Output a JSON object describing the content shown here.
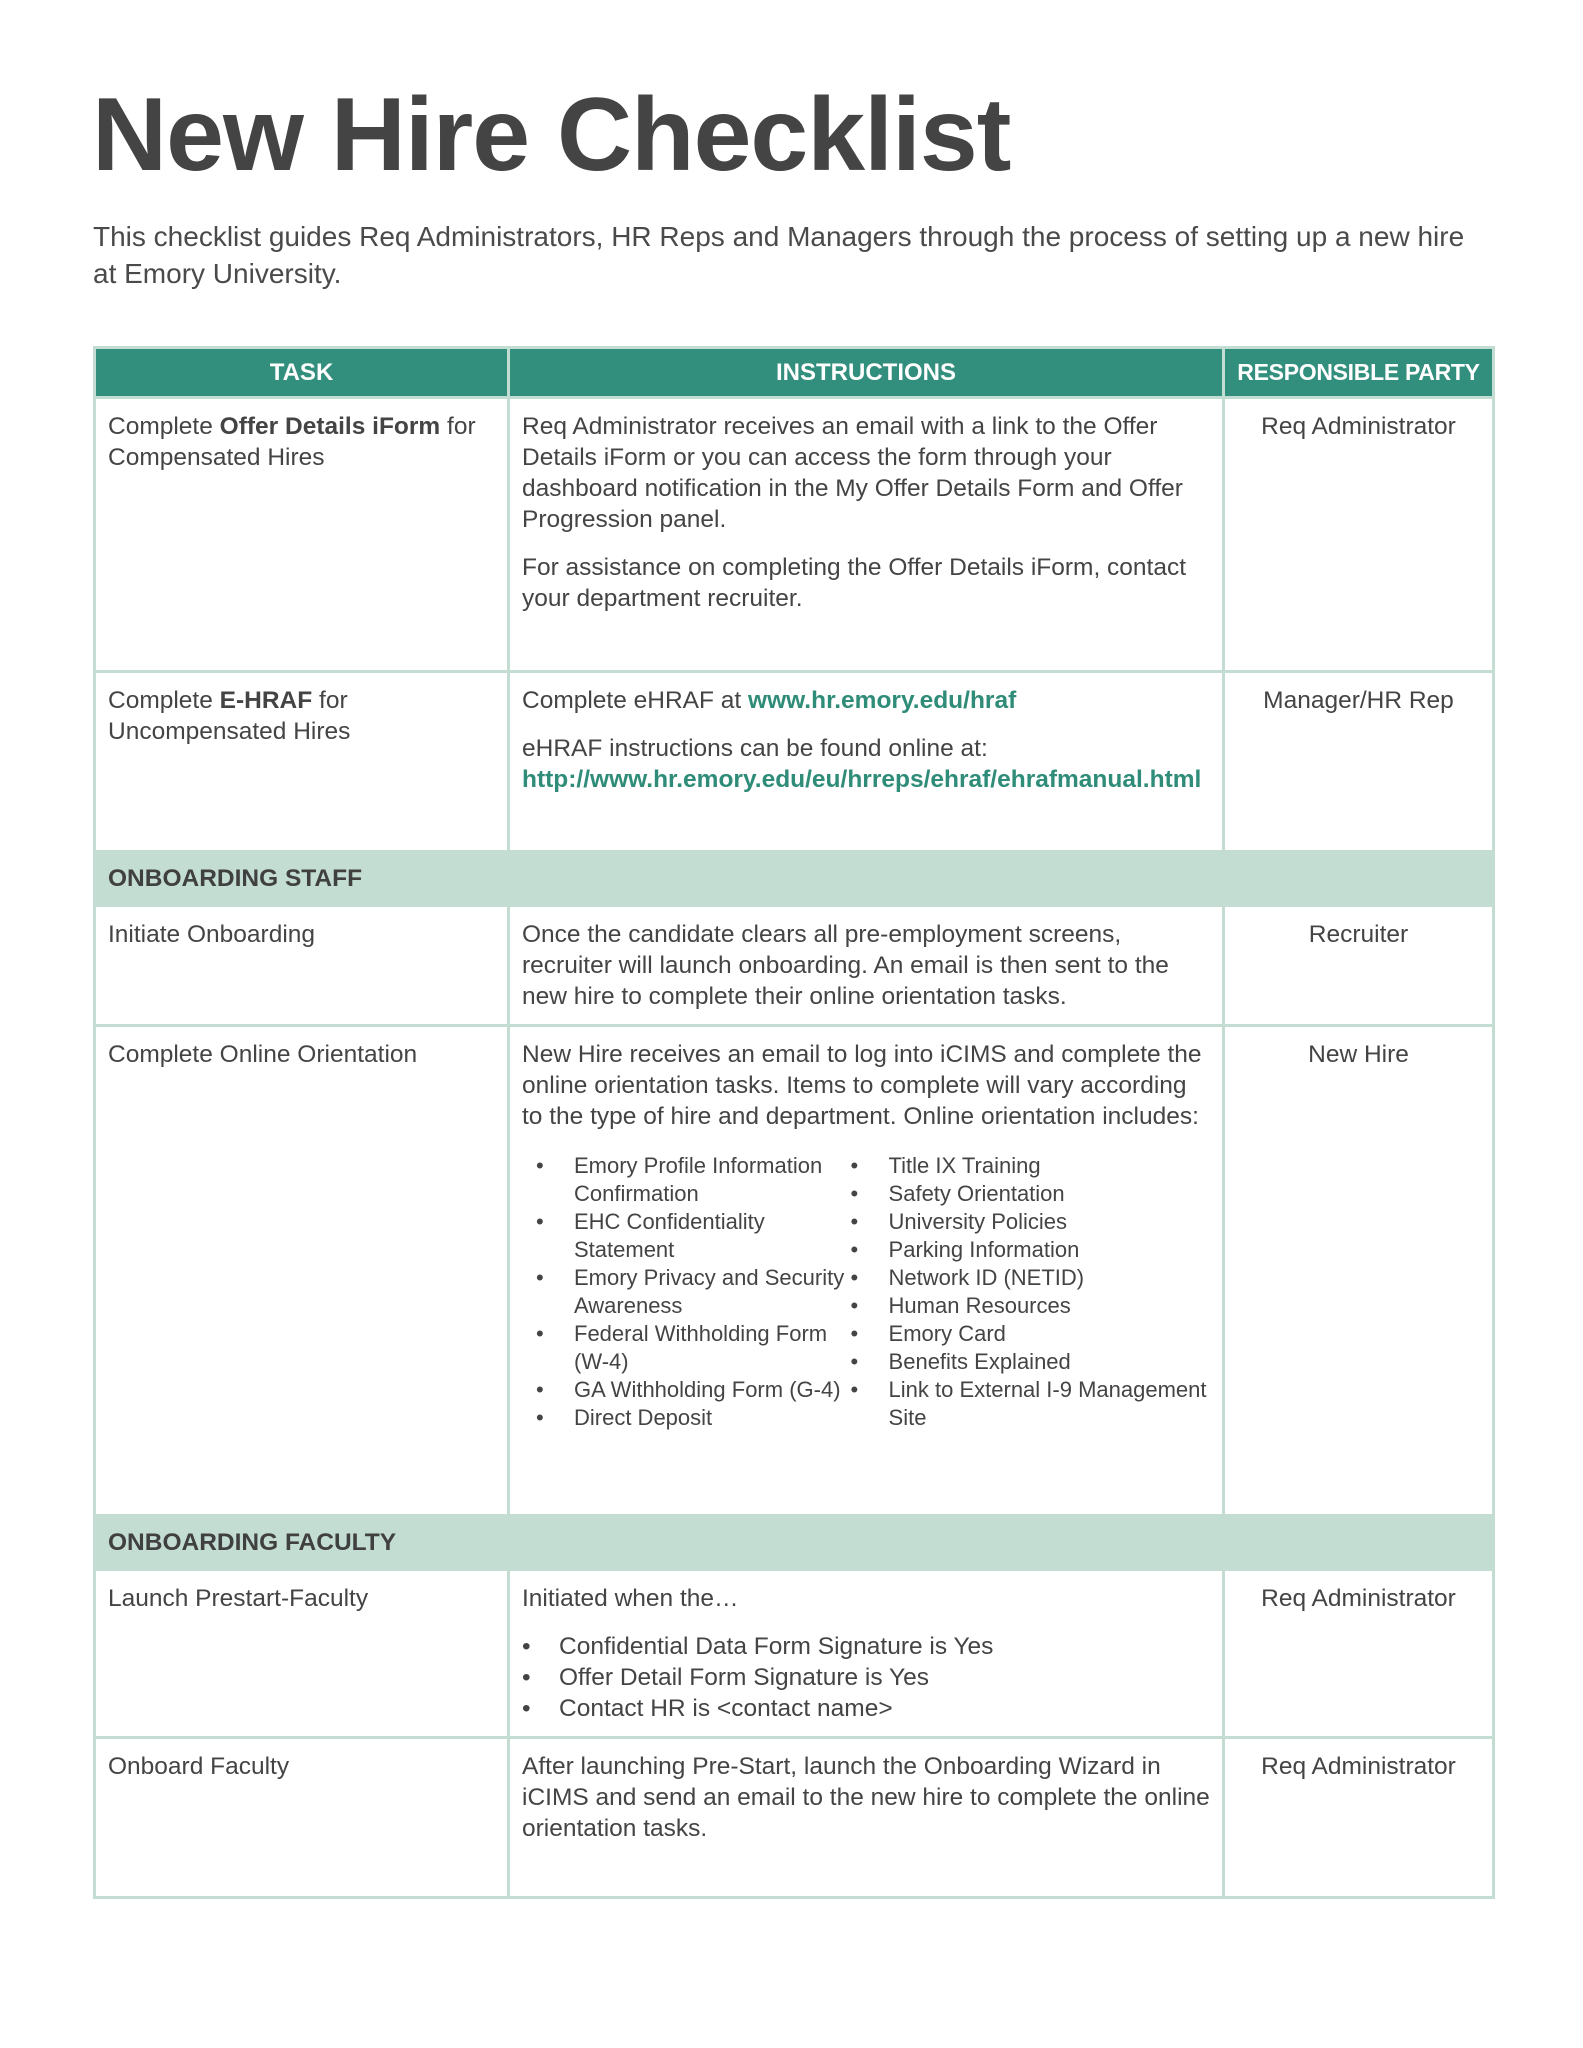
{
  "document": {
    "title": "New Hire Checklist",
    "intro": "This checklist guides Req Administrators, HR Reps and Managers through the process of setting up a new hire at Emory University."
  },
  "colors": {
    "header_bg": "#338f7d",
    "section_bg": "#c3ddd3",
    "link": "#2f8c78",
    "text": "#444444"
  },
  "table": {
    "headers": [
      "TASK",
      "INSTRUCTIONS",
      "RESPONSIBLE PARTY"
    ],
    "rows": [
      {
        "task_pre": "Complete ",
        "task_bold": "Offer Details iForm",
        "task_post": " for Compensated Hires",
        "instructions": [
          "Req Administrator receives an email with a link to the Offer Details iForm or you can access the form through your dashboard notification in the My Offer Details Form and Offer Progression panel.",
          "For assistance on completing the Offer Details iForm, contact your department recruiter."
        ],
        "party": "Req Administrator"
      },
      {
        "task_pre": "Complete ",
        "task_bold": "E-HRAF",
        "task_post": " for Uncompensated Hires",
        "instr1_text": "Complete eHRAF at ",
        "instr1_link": "www.hr.emory.edu/hraf",
        "instr2_text": "eHRAF instructions can be found online at:",
        "instr2_link": "http://www.hr.emory.edu/eu/hrreps/ehraf/ehrafmanual.html",
        "party": "Manager/HR Rep"
      }
    ],
    "section_staff": {
      "label": "ONBOARDING STAFF",
      "rows": [
        {
          "task": "Initiate Onboarding",
          "instructions": "Once the candidate clears all pre-employment screens, recruiter will launch onboarding. An email is then sent to the new hire to complete their online orientation tasks.",
          "party": "Recruiter"
        },
        {
          "task": "Complete Online Orientation",
          "instructions": "New Hire receives an email to log into iCIMS and complete the online orientation tasks. Items to complete will vary according to the type of hire and department. Online orientation includes:",
          "list_left": [
            "Emory Profile Information Confirmation",
            "EHC Confidentiality Statement",
            "Emory Privacy and Security Awareness",
            "Federal Withholding Form (W-4)",
            "GA Withholding Form (G-4)",
            "Direct Deposit"
          ],
          "list_right": [
            "Title IX Training",
            "Safety Orientation",
            "University Policies",
            "Parking Information",
            "Network ID (NETID)",
            "Human Resources",
            "Emory Card",
            "Benefits Explained",
            "Link to External I-9 Management Site"
          ],
          "party": "New Hire"
        }
      ]
    },
    "section_faculty": {
      "label": "ONBOARDING FACULTY",
      "rows": [
        {
          "task": "Launch Prestart-Faculty",
          "instructions": "Initiated when the…",
          "conditions": [
            "Confidential Data Form Signature is Yes",
            "Offer Detail Form Signature is Yes",
            "Contact HR is <contact name>"
          ],
          "party": "Req Administrator"
        },
        {
          "task": "Onboard Faculty",
          "instructions": "After launching Pre-Start, launch the Onboarding Wizard in iCIMS and send an email to the new hire to complete the online orientation tasks.",
          "party": "Req Administrator"
        }
      ]
    }
  }
}
